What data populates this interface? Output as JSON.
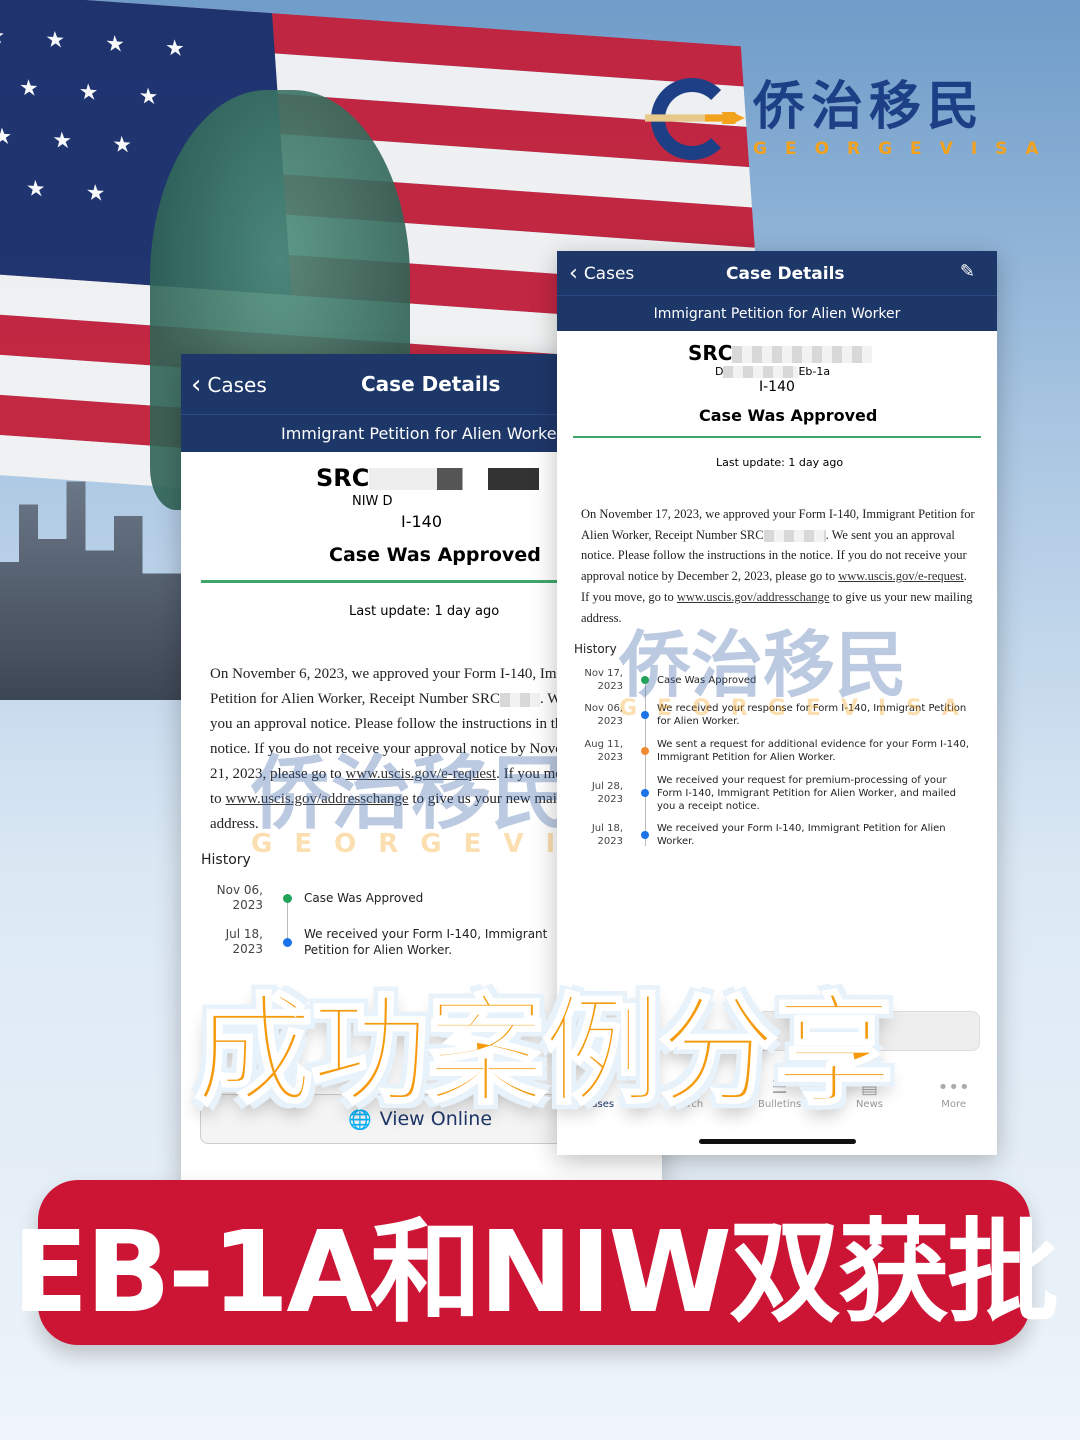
{
  "brand": {
    "name_cn": "侨治移民",
    "name_en": "GEORGEVISA",
    "colors": {
      "navy": "#1d3f86",
      "orange": "#f3a21d"
    }
  },
  "left_card": {
    "back_label": "Cases",
    "title": "Case Details",
    "subtitle": "Immigrant Petition for Alien Worker",
    "receipt_prefix": "SRC",
    "category": "NIW D",
    "form": "I-140",
    "status": "Case Was Approved",
    "last_update": "Last update: 1 day ago",
    "message": {
      "p1": "On November 6, 2023, we approved your Form I-140, Immigrant Petition for Alien Worker, Receipt Number SRC",
      "p2": ". We sent you an approval notice. Please follow the instructions in the notice. If you do not receive your approval notice by November 21, 2023, please go to ",
      "link1": "www.uscis.gov/e-request",
      "p3": ". If you move, go to ",
      "link2": "www.uscis.gov/addresschange",
      "p4": " to give us your new mailing address."
    },
    "history_label": "History",
    "history": [
      {
        "date": "Nov 06,",
        "year": "2023",
        "text": "Case Was Approved",
        "color": "#21a35a"
      },
      {
        "date": "Jul 18,",
        "year": "2023",
        "text": "We received your Form I-140, Immigrant Petition for Alien Worker.",
        "color": "#1a73e8"
      }
    ],
    "view_online": "View Online"
  },
  "right_card": {
    "back_label": "Cases",
    "title": "Case Details",
    "subtitle": "Immigrant Petition for Alien Worker",
    "receipt_prefix": "SRC",
    "category_prefix": "D",
    "category_suffix": "Eb-1a",
    "form": "I-140",
    "status": "Case Was Approved",
    "last_update": "Last update: 1 day ago",
    "message": {
      "p1": "On November 17, 2023, we approved your Form I-140, Immigrant Petition for Alien Worker, Receipt Number SRC",
      "p2": ". We sent you an approval notice. Please follow the instructions in the notice. If you do not receive your approval notice by December 2, 2023, please go to ",
      "link1": "www.uscis.gov/e-request",
      "p3": ". If you move, go to ",
      "link2": "www.uscis.gov/addresschange",
      "p4": " to give us your new mailing address."
    },
    "history_label": "History",
    "history": [
      {
        "date": "Nov 17,",
        "year": "2023",
        "text": "Case Was Approved",
        "color": "#21a35a"
      },
      {
        "date": "Nov 06,",
        "year": "2023",
        "text": "We received your response for Form I-140, Immigrant Petition for Alien Worker.",
        "color": "#1a73e8"
      },
      {
        "date": "Aug 11,",
        "year": "2023",
        "text": "We sent a request for additional evidence for your Form I-140, Immigrant Petition for Alien Worker.",
        "color": "#f08a30"
      },
      {
        "date": "Jul 28,",
        "year": "2023",
        "text": "We received your request for premium-processing of your Form I-140, Immigrant Petition for Alien Worker, and mailed you a receipt notice.",
        "color": "#1a73e8"
      },
      {
        "date": "Jul 18,",
        "year": "2023",
        "text": "We received your Form I-140, Immigrant Petition for Alien Worker.",
        "color": "#1a73e8"
      }
    ],
    "tabs": [
      {
        "label": "Cases",
        "icon": "briefcase-icon"
      },
      {
        "label": "Search",
        "icon": "search-icon"
      },
      {
        "label": "Bulletins",
        "icon": "list-icon"
      },
      {
        "label": "News",
        "icon": "newspaper-icon"
      },
      {
        "label": "More",
        "icon": "more-icon"
      }
    ]
  },
  "headline": "成功案例分享",
  "banner": "EB-1A和NIW双获批"
}
